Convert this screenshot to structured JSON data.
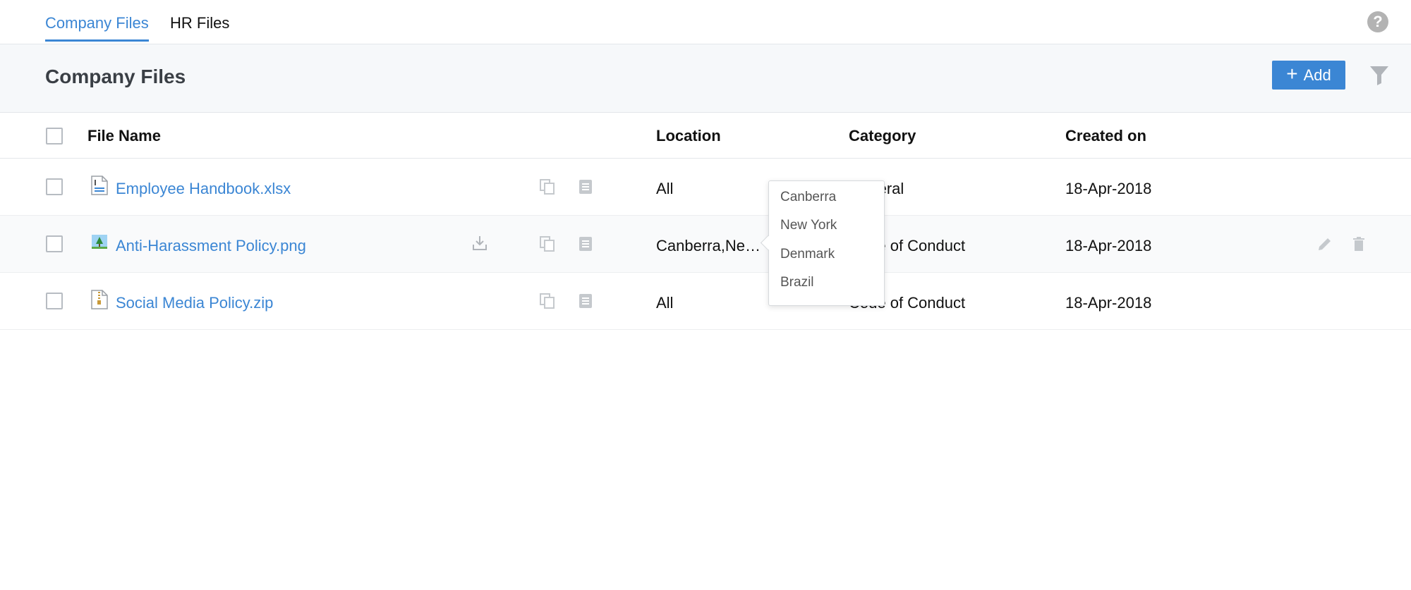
{
  "tabs": {
    "company_label": "Company Files",
    "hr_label": "HR Files"
  },
  "help_icon_glyph": "?",
  "header": {
    "title": "Company Files",
    "add_label": "Add",
    "add_glyph": "+"
  },
  "table": {
    "columns": {
      "file_name": "File Name",
      "location": "Location",
      "category": "Category",
      "created_on": "Created on"
    },
    "rows": [
      {
        "file": "Employee Handbook.xlsx",
        "icon": "spreadsheet-file-icon",
        "location": "All",
        "category": "General",
        "created": "18-Apr-2018"
      },
      {
        "file": "Anti-Harassment Policy.png",
        "icon": "image-file-icon",
        "location": "Canberra,Ne…",
        "category": "Code of Conduct",
        "created": "18-Apr-2018"
      },
      {
        "file": "Social Media Policy.zip",
        "icon": "zip-file-icon",
        "location": "All",
        "category": "Code of Conduct",
        "created": "18-Apr-2018"
      }
    ]
  },
  "location_popover": {
    "items": [
      "Canberra",
      "New York",
      "Denmark",
      "Brazil"
    ]
  },
  "colors": {
    "accent": "#3b86d4",
    "header_band": "#f6f8fa",
    "icon_grey": "#b0b4b9"
  }
}
